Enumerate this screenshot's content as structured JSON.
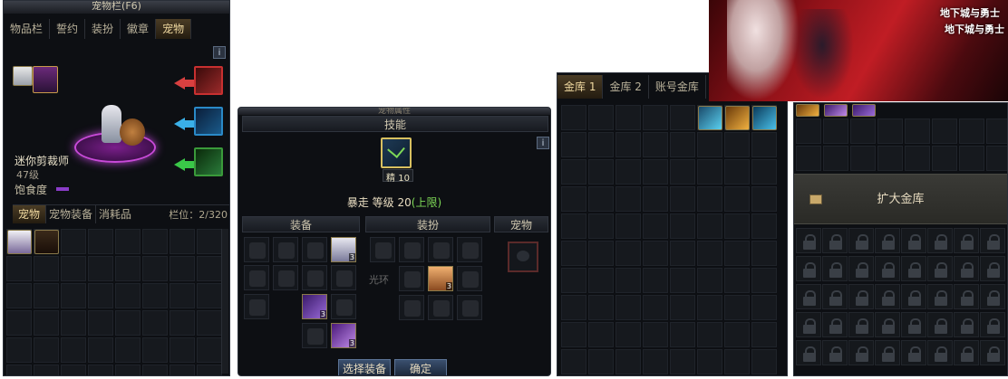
{
  "panel1": {
    "title": "宠物栏(F6)",
    "tabs": [
      "物品栏",
      "誓约",
      "装扮",
      "徽章",
      "宠物"
    ],
    "info": "i",
    "pet_name": "迷你剪裁师",
    "pet_level": "47级",
    "satiety_label": "饱食度",
    "subtabs": [
      "宠物",
      "宠物装备",
      "消耗品"
    ],
    "capacity": "栏位：2/320"
  },
  "panel2": {
    "title": "宠物属性",
    "skill_header": "技能",
    "skill_level_badge": "精 10",
    "skill_status_a": "暴走 等级 20",
    "skill_status_b": "(上限)",
    "equip_header": "装备",
    "avatar_header": "装扮",
    "pet_header": "宠物",
    "aura_label": "光环",
    "select_button": "选择装备",
    "confirm_button": "确定",
    "badge_3": "3"
  },
  "panel3": {
    "tabs": [
      "金库 1",
      "金库 2",
      "账号金库"
    ]
  },
  "panel4": {
    "expand_label": "扩大金库"
  },
  "banner": {
    "logo_a": "地下城与勇士",
    "logo_b": "地下城与勇士"
  },
  "colors": {
    "accent_gold": "#f0d9a0",
    "status_green": "#7ed957",
    "satiety_purple": "#8a3cc8"
  },
  "icons": {
    "arrow_red": "arrow-left-icon",
    "arrow_blue": "arrow-left-icon",
    "arrow_green": "arrow-left-icon",
    "lock": "lock-icon"
  }
}
